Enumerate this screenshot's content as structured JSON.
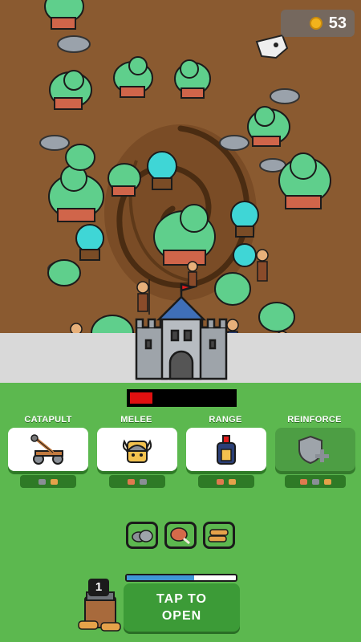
{
  "hud": {
    "coins": "53",
    "coin_icon": "gold-coin-icon"
  },
  "castle": {
    "health_fraction": 0.22,
    "health_color": "#e01010"
  },
  "units": [
    {
      "label": "CATAPULT",
      "icon": "catapult-icon",
      "enabled": true
    },
    {
      "label": "MELEE",
      "icon": "viking-helmet-icon",
      "enabled": true
    },
    {
      "label": "RANGE",
      "icon": "spartan-helmet-icon",
      "enabled": true
    },
    {
      "label": "REINFORCE",
      "icon": "shield-plus-icon",
      "enabled": false
    }
  ],
  "costs": [
    [
      "stone-icon",
      "wood-icon"
    ],
    [
      "meat-icon",
      "stone-icon"
    ],
    [
      "meat-icon",
      "wood-icon"
    ],
    [
      "meat-icon",
      "stone-icon",
      "wood-icon"
    ]
  ],
  "resources": [
    "stone-icon",
    "meat-icon",
    "wood-icon"
  ],
  "chest": {
    "count": "1",
    "progress_fraction": 0.62,
    "open_label": "TAP TO OPEN"
  },
  "colors": {
    "grass": "#5cb84f",
    "dirt": "#8a5a30",
    "button_dark": "#3c9b37",
    "progress": "#3f97d8"
  }
}
